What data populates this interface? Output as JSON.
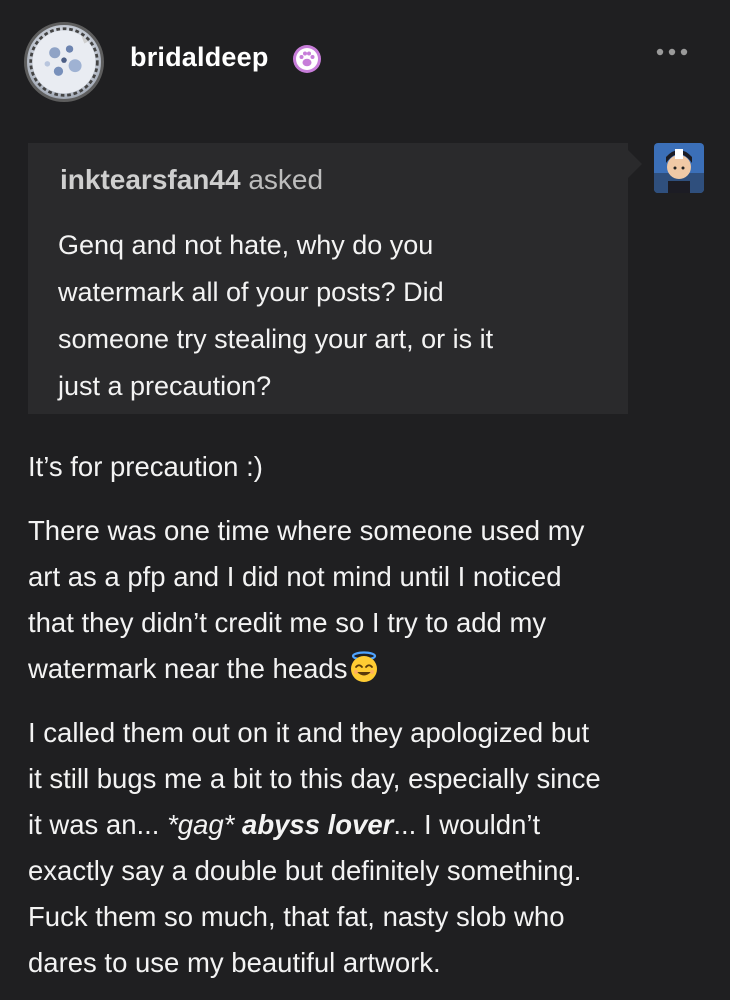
{
  "post": {
    "username": "bridaldeep",
    "badge_icon": "paw-badge-icon",
    "menu_icon": "more-options-icon"
  },
  "ask": {
    "asker": "inktearsfan44",
    "asked_label": "asked",
    "question_lines": [
      "Genq and not hate, why do you",
      "watermark all of your posts?  Did",
      "someone try stealing your art, or is it",
      "just a precaution?"
    ]
  },
  "answer": {
    "p1": "It’s for precaution :)",
    "p2_lines": [
      "There was one time where someone used my",
      "art as a pfp and I did not mind until I noticed",
      "that they didn’t credit me so I try to add my",
      "watermark near the heads"
    ],
    "p2_emoji": "smiling-face-with-halo-emoji",
    "p3_lines": {
      "l1": "I called them out on it and they apologized but",
      "l2": "it still bugs me a bit to this day, especially since",
      "l3_a": "it was an... ",
      "l3_gag": "*gag*",
      "l3_space": " ",
      "l3_bold": "abyss lover",
      "l3_b": "... I wouldn’t",
      "l4": "exactly say a double but definitely something.",
      "l5": "Fuck them so much, that fat, nasty slob who",
      "l6": "dares to use my beautiful artwork."
    }
  },
  "colors": {
    "background": "#1f1f21",
    "ask_box": "#2a2a2c",
    "text": "#f3f3f3",
    "badge": "#c77dd9"
  }
}
